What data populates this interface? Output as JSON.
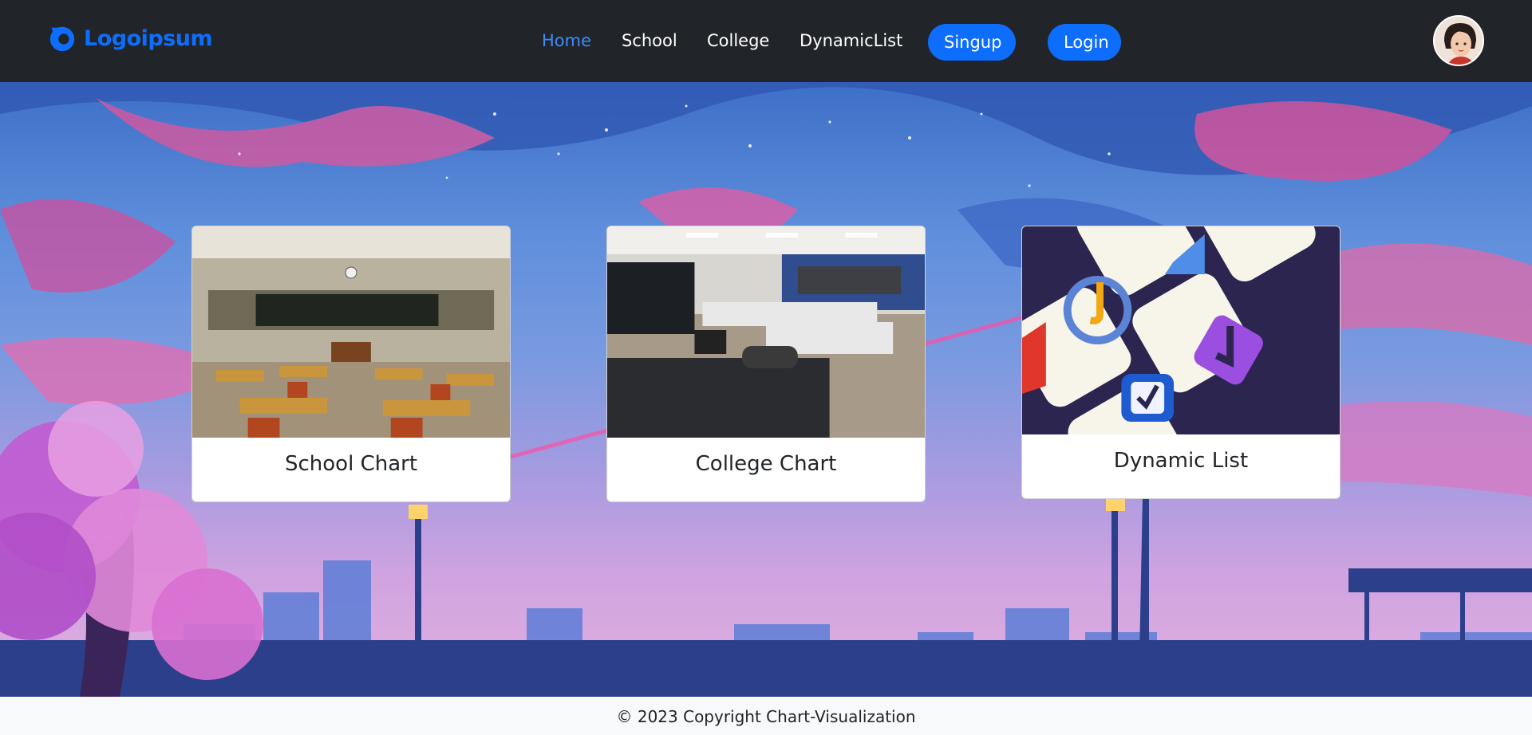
{
  "brand": {
    "name": "Logoipsum",
    "color": "#0d6efd"
  },
  "nav": {
    "links": [
      {
        "label": "Home",
        "active": true
      },
      {
        "label": "School"
      },
      {
        "label": "College"
      },
      {
        "label": "DynamicList"
      }
    ],
    "signup_label": "Singup",
    "login_label": "Login"
  },
  "cards": [
    {
      "title": "School Chart",
      "image": "classroom-photo"
    },
    {
      "title": "College Chart",
      "image": "lecture-hall-photo"
    },
    {
      "title": "Dynamic List",
      "image": "checklist-app-icons"
    }
  ],
  "footer": {
    "text": "© 2023 Copyright Chart-Visualization"
  },
  "colors": {
    "navbar": "#212529",
    "accent": "#0d6efd",
    "footer_bg": "#f8f9fa"
  }
}
